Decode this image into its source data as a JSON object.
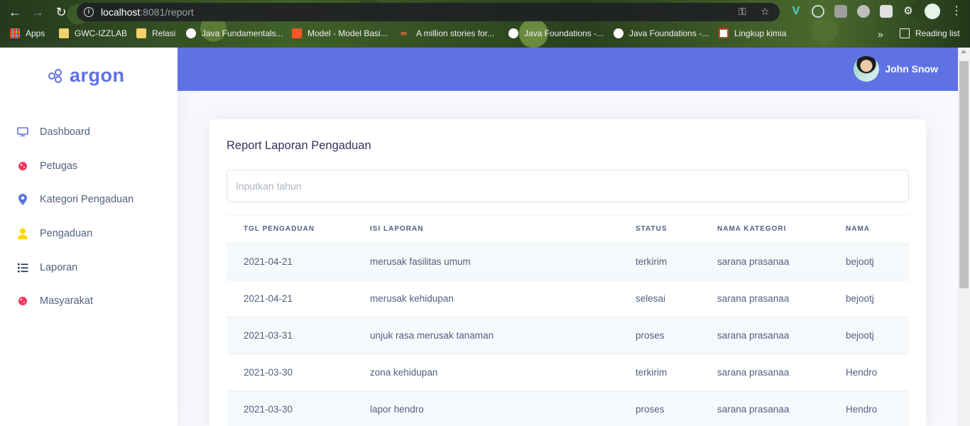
{
  "browser": {
    "url_host": "localhost",
    "url_path": ":8081/report",
    "bookmarks": [
      {
        "label": "Apps",
        "icon": "apps-grid-icon",
        "color": "#f4b400"
      },
      {
        "label": "GWC-IZZLAB",
        "icon": "folder-icon",
        "color": "#f6d36b"
      },
      {
        "label": "Relasi",
        "icon": "folder-icon",
        "color": "#f6d36b"
      },
      {
        "label": "Java Fundamentals...",
        "icon": "globe-icon",
        "color": "#ffffff"
      },
      {
        "label": "Model - Model Basi...",
        "icon": "blogger-icon",
        "color": "#ff5722"
      },
      {
        "label": "A million stories for...",
        "icon": "infinity-icon",
        "color": "#e91e63"
      },
      {
        "label": "Java Foundations -...",
        "icon": "globe-icon",
        "color": "#ffffff"
      },
      {
        "label": "Java Foundations -...",
        "icon": "globe-icon",
        "color": "#ffffff"
      },
      {
        "label": "Lingkup kimia",
        "icon": "g-logo-icon",
        "color": "#e53935"
      }
    ],
    "more": "»",
    "reading_list": "Reading list"
  },
  "brand": {
    "name": "argon",
    "color": "#5e72e4"
  },
  "sidebar": {
    "items": [
      {
        "label": "Dashboard",
        "icon": "monitor-icon",
        "color": "#5e72e4"
      },
      {
        "label": "Petugas",
        "icon": "planet-icon",
        "color": "#f5365c"
      },
      {
        "label": "Kategori Pengaduan",
        "icon": "pin-icon",
        "color": "#5e72e4"
      },
      {
        "label": "Pengaduan",
        "icon": "user-icon",
        "color": "#ffd600"
      },
      {
        "label": "Laporan",
        "icon": "list-icon",
        "color": "#172b4d"
      },
      {
        "label": "Masyarakat",
        "icon": "planet-icon",
        "color": "#f5365c"
      }
    ]
  },
  "header": {
    "user_name": "John Snow"
  },
  "report": {
    "title": "Report Laporan Pengaduan",
    "search_placeholder": "Inputkan tahun",
    "search_value": "",
    "columns": [
      "TGL PENGADUAN",
      "ISI LAPORAN",
      "STATUS",
      "NAMA KATEGORI",
      "NAMA"
    ],
    "rows": [
      [
        "2021-04-21",
        "merusak fasilitas umum",
        "terkirim",
        "sarana prasanaa",
        "bejootj"
      ],
      [
        "2021-04-21",
        "merusak kehidupan",
        "selesai",
        "sarana prasanaa",
        "bejootj"
      ],
      [
        "2021-03-31",
        "unjuk rasa merusak tanaman",
        "proses",
        "sarana prasanaa",
        "bejootj"
      ],
      [
        "2021-03-30",
        "zona kehidupan",
        "terkirim",
        "sarana prasanaa",
        "Hendro"
      ],
      [
        "2021-03-30",
        "lapor hendro",
        "proses",
        "sarana prasanaa",
        "Hendro"
      ]
    ]
  }
}
